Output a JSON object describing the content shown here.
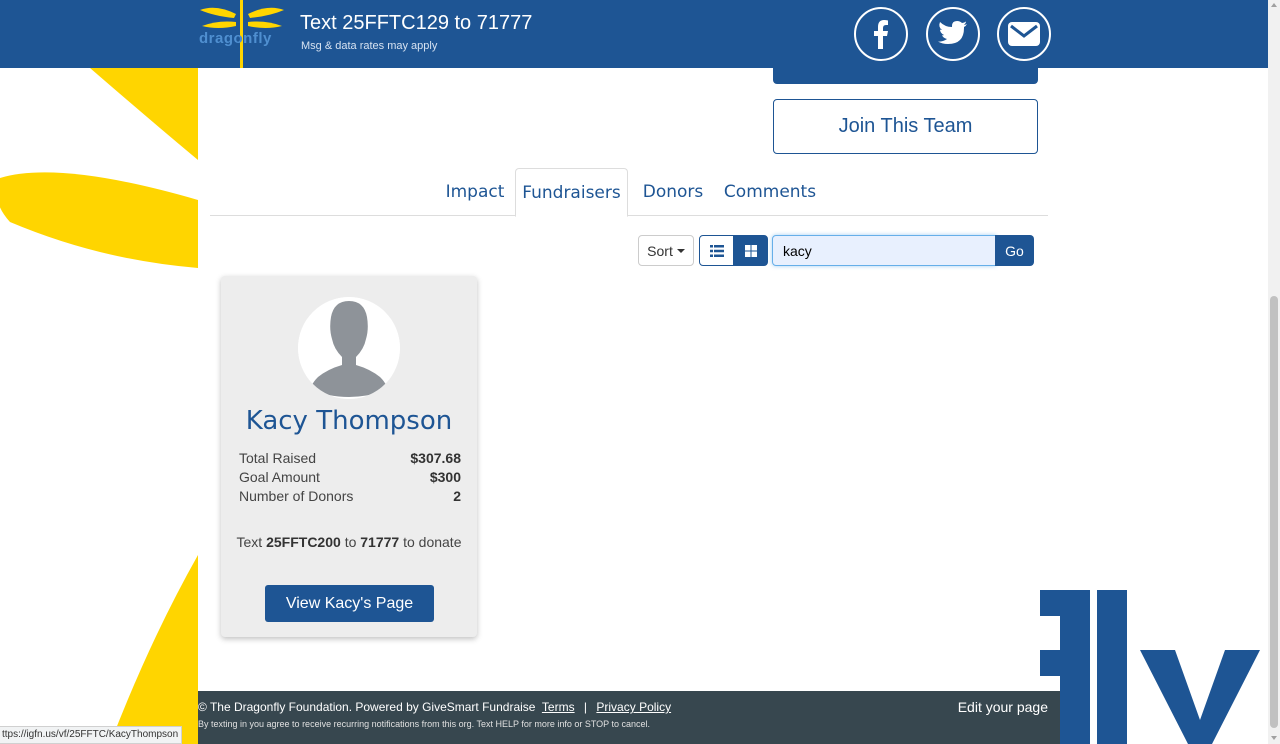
{
  "header": {
    "logo_text": "dragonfly",
    "text_cta": "Text 25FFTC129 to 71777",
    "text_sub": "Msg & data rates may apply",
    "social": [
      "facebook-icon",
      "twitter-icon",
      "email-icon"
    ]
  },
  "actions": {
    "join_label": "Join This Team"
  },
  "tabs": [
    {
      "label": "Impact",
      "active": false
    },
    {
      "label": "Fundraisers",
      "active": true
    },
    {
      "label": "Donors",
      "active": false
    },
    {
      "label": "Comments",
      "active": false
    }
  ],
  "toolbar": {
    "sort_label": "Sort",
    "view_mode": "grid",
    "search_value": "kacy",
    "go_label": "Go"
  },
  "fundraisers": [
    {
      "name": "Kacy Thompson",
      "stats": [
        {
          "label": "Total Raised",
          "value": "$307.68"
        },
        {
          "label": "Goal Amount",
          "value": "$300"
        },
        {
          "label": "Number of Donors",
          "value": "2"
        }
      ],
      "text_prefix": "Text",
      "text_code": "25FFTC200",
      "text_to": "to",
      "text_number": "71777",
      "text_suffix": "to donate",
      "button_label": "View Kacy's Page"
    }
  ],
  "footer": {
    "copyright": "© The Dragonfly Foundation. Powered by GiveSmart Fundraise",
    "terms": "Terms",
    "separator": "|",
    "privacy": "Privacy Policy",
    "notice": "By texting in you agree to receive recurring notifications from this org. Text HELP for more info or STOP to cancel.",
    "edit_label": "Edit your page"
  },
  "status_url": "ttps://igfn.us/vf/25FFTC/KacyThompson",
  "colors": {
    "brand_blue": "#1e5594",
    "accent_yellow": "#ffd500",
    "footer_bg": "#37474f",
    "card_bg": "#ededed"
  }
}
